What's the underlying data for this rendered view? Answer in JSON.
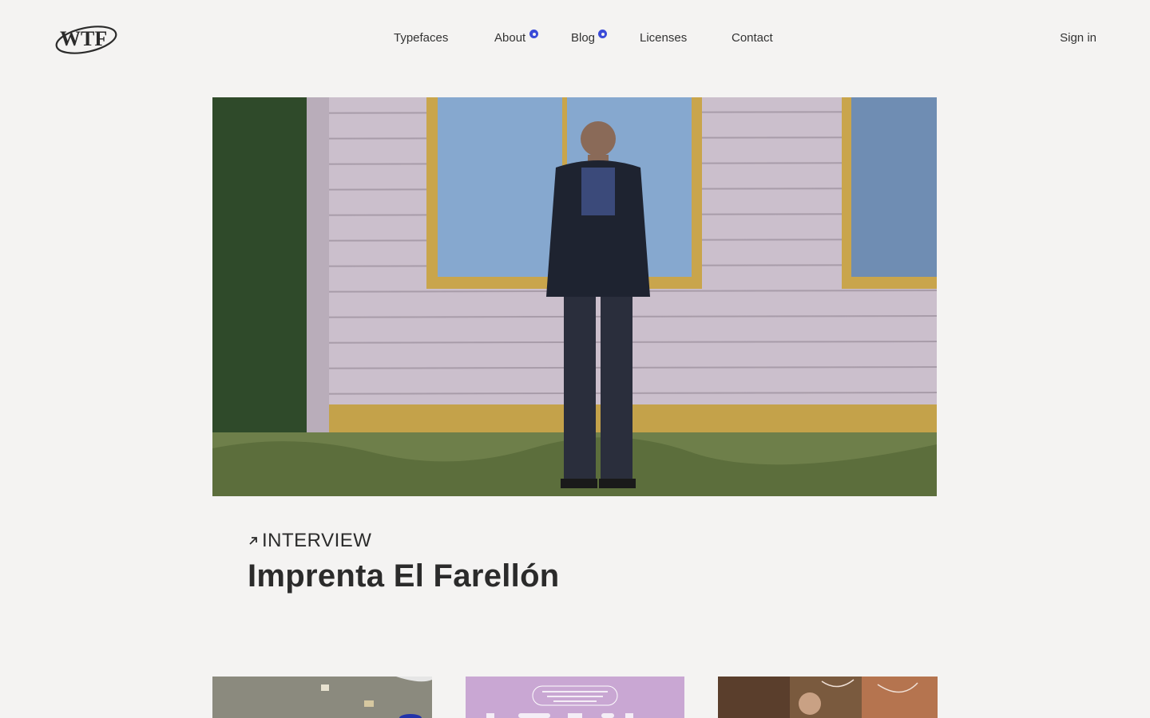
{
  "brand": {
    "logo_text": "WTF"
  },
  "nav": {
    "items": [
      {
        "label": "Typefaces",
        "has_dot": false
      },
      {
        "label": "About",
        "has_dot": true
      },
      {
        "label": "Blog",
        "has_dot": true
      },
      {
        "label": "Licenses",
        "has_dot": false
      },
      {
        "label": "Contact",
        "has_dot": false
      }
    ],
    "sign_in": "Sign in"
  },
  "article": {
    "kicker": "INTERVIEW",
    "title": "Imprenta El Farellón"
  },
  "colors": {
    "background": "#f4f3f2",
    "text": "#2b2b2b",
    "accent_dot": "#3a4bd8"
  }
}
